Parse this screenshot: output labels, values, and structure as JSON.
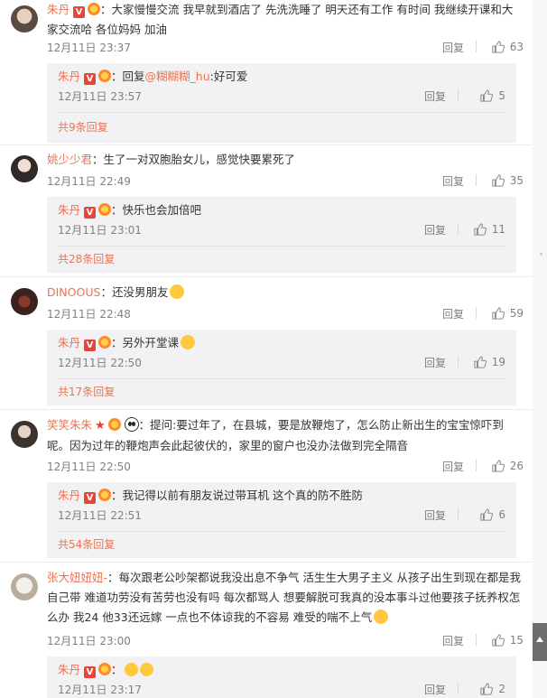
{
  "comments": [
    {
      "user": "朱丹",
      "text": "：大家慢慢交流 我早就到酒店了 先洗洗睡了 明天还有工作 有时间 我继续开课和大家交流哈 各位妈妈 加油",
      "time": "12月11日 23:37",
      "reply_label": "回复",
      "likes": "63",
      "replies": [
        {
          "user": "朱丹",
          "prefix": "：回复",
          "mention": "@糊糊糊_hu",
          "text": ":好可爱",
          "time": "12月11日 23:57",
          "reply_label": "回复",
          "likes": "5"
        }
      ],
      "more": "共9条回复"
    },
    {
      "user": "姚少少君",
      "text": "：生了一对双胞胎女儿，感觉快要累死了",
      "time": "12月11日 22:49",
      "reply_label": "回复",
      "likes": "35",
      "replies": [
        {
          "user": "朱丹",
          "text": "：快乐也会加倍吧",
          "time": "12月11日 23:01",
          "reply_label": "回复",
          "likes": "11"
        }
      ],
      "more": "共28条回复"
    },
    {
      "user": "DINOOUS",
      "text": "：还没男朋友",
      "time": "12月11日 22:48",
      "reply_label": "回复",
      "likes": "59",
      "replies": [
        {
          "user": "朱丹",
          "text": "：另外开堂课",
          "time": "12月11日 22:50",
          "reply_label": "回复",
          "likes": "19"
        }
      ],
      "more": "共17条回复"
    },
    {
      "user": "笑笑朱朱",
      "text": "：提问:要过年了，在县城，要是放鞭炮了，怎么防止新出生的宝宝惊吓到呢。因为过年的鞭炮声会此起彼伏的，家里的窗户也没办法做到完全隔音",
      "time": "12月11日 22:50",
      "reply_label": "回复",
      "likes": "26",
      "replies": [
        {
          "user": "朱丹",
          "text": "：我记得以前有朋友说过带耳机 这个真的防不胜防",
          "time": "12月11日 22:51",
          "reply_label": "回复",
          "likes": "6"
        }
      ],
      "more": "共54条回复"
    },
    {
      "user": "张大妞妞妞-",
      "text": "：每次跟老公吵架都说我没出息不争气 活生生大男子主义 从孩子出生到现在都是我自己带 难道功劳没有苦劳也没有吗 每次都骂人 想要解脱可我真的没本事斗过他要孩子抚养权怎么办 我24 他33还远嫁 一点也不体谅我的不容易 难受的喘不上气",
      "time": "12月11日 23:00",
      "reply_label": "回复",
      "likes": "15",
      "replies": [
        {
          "user": "朱丹",
          "text": "：",
          "time": "12月11日 23:17",
          "reply_label": "回复",
          "likes": "2"
        }
      ]
    }
  ],
  "badges": {
    "verified": "V"
  },
  "colors": {
    "accent": "#eb7350",
    "muted": "#808080",
    "reply_bg": "#f2f2f5"
  },
  "icons": [
    "thumbs-up-icon",
    "verified-badge-icon",
    "fan-badge-icon",
    "emoji-icon",
    "panda-icon"
  ]
}
